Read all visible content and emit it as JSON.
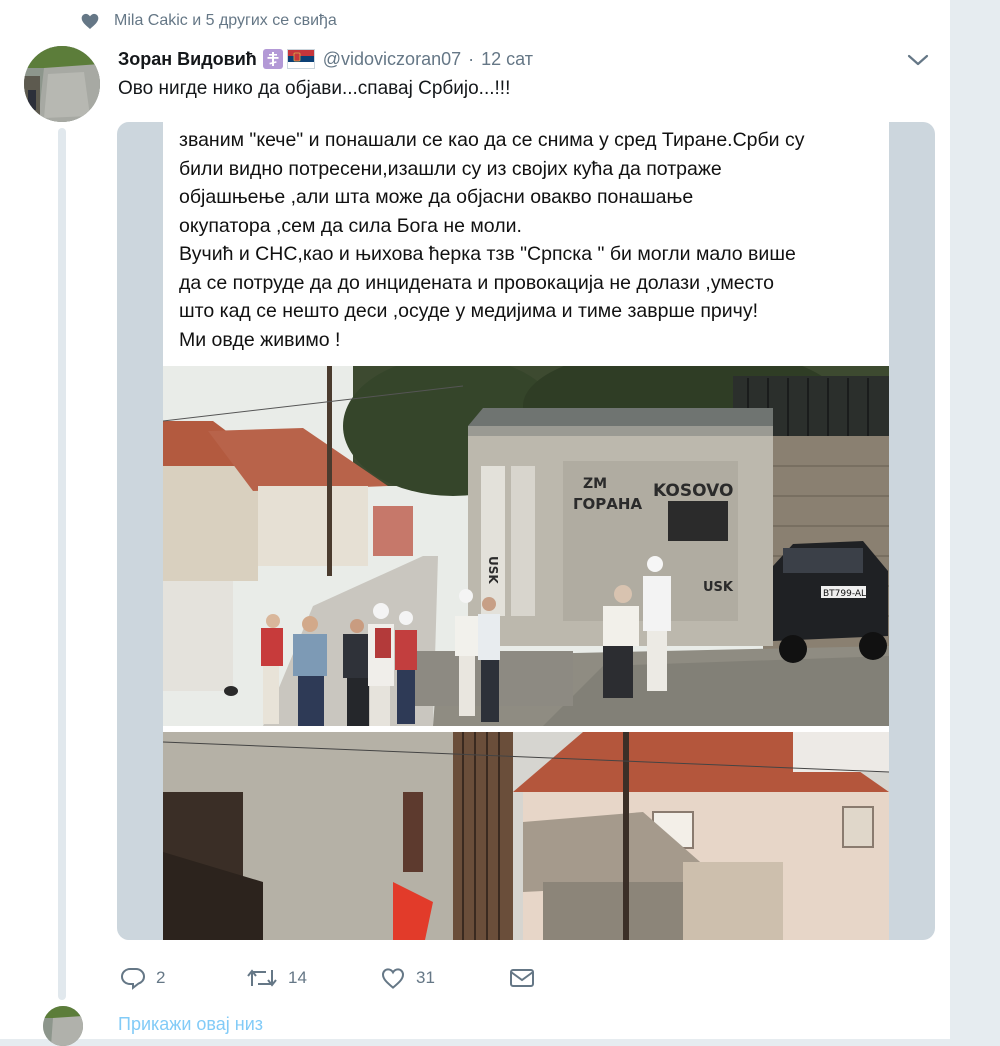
{
  "social_context": {
    "icon": "heart-icon",
    "text": "Mila Cakic и 5 других се свиђа"
  },
  "tweet": {
    "author_name": "Зоран Видовић",
    "badges": [
      "orthodox-cross-icon",
      "serbian-flag-icon"
    ],
    "handle": "@vidoviczoran07",
    "separator": "·",
    "time": "12 сат",
    "text": "Ово нигде нико да објави...спавај Србијо...!!!",
    "media": {
      "post_text_lines": [
        "званим \"кече\" и понашали се као да се снима у сред Тиране.Срби су",
        "били видно потресени,изашли су из својих кућа да потраже",
        "објашњење ,али шта може да објасни овакво понашање",
        "окупатора ,сем да сила Бога не моли.",
        "Вучић и СНС,као и њихова ћерка тзв \"Српска \" би могли мало више",
        "да се потруде да до инцидената и провокација не долази ,уместо",
        "што кад се нешто деси ,осуде у медијима и тиме заврше причу!",
        "Ми овде живимо !"
      ],
      "photo_graffiti": {
        "line1": "ZM",
        "line2": "ГОРАНА",
        "line3": "KOSOVO",
        "line4": "USK",
        "side": "USK",
        "plate": "BT799-AL"
      }
    },
    "actions": {
      "reply_count": "2",
      "retweet_count": "14",
      "like_count": "31"
    }
  },
  "show_thread": {
    "label": "Прикажи овај низ"
  },
  "colors": {
    "accent": "#1da1f2",
    "secondary_text": "#657786",
    "primary_text": "#14171a",
    "background": "#e6ecf0",
    "card": "#ffffff"
  }
}
